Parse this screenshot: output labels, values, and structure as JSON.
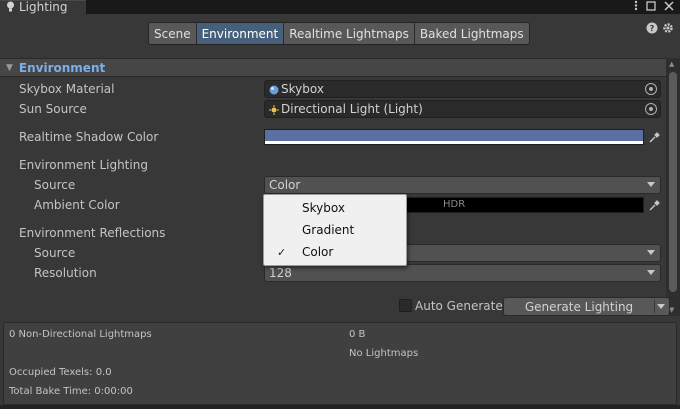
{
  "window": {
    "tab_title": "Lighting",
    "menu_icon": "kebab-icon",
    "maximize_icon": "maximize-icon",
    "close_icon": "close-icon"
  },
  "toolbar": {
    "help_icon": "help-icon",
    "settings_icon": "gear-icon",
    "tabs": [
      {
        "label": "Scene",
        "active": false
      },
      {
        "label": "Environment",
        "active": true
      },
      {
        "label": "Realtime Lightmaps",
        "active": false
      },
      {
        "label": "Baked Lightmaps",
        "active": false
      }
    ]
  },
  "section": {
    "title": "Environment"
  },
  "fields": {
    "skybox_material_label": "Skybox Material",
    "skybox_material_value": "Skybox",
    "sun_source_label": "Sun Source",
    "sun_source_value": "Directional Light (Light)",
    "realtime_shadow_color_label": "Realtime Shadow Color",
    "realtime_shadow_color": "#5c6fa3",
    "environment_lighting_label": "Environment Lighting",
    "source_label": "Source",
    "source_value": "Color",
    "ambient_color_label": "Ambient Color",
    "ambient_color": "#000000",
    "ambient_hdr_label": "HDR",
    "environment_reflections_label": "Environment Reflections",
    "reflections_source_label": "Source",
    "resolution_label": "Resolution",
    "resolution_value": "128"
  },
  "source_popup": {
    "options": [
      {
        "label": "Skybox",
        "checked": false
      },
      {
        "label": "Gradient",
        "checked": false
      },
      {
        "label": "Color",
        "checked": true
      }
    ],
    "check_glyph": "✓"
  },
  "bake": {
    "auto_generate_label": "Auto Generate",
    "auto_generate_checked": false,
    "generate_button_label": "Generate Lighting"
  },
  "stats": {
    "lightmaps": "0 Non-Directional Lightmaps",
    "size": "0 B",
    "no_lightmaps": "No Lightmaps",
    "occupied_texels": "Occupied Texels: 0.0",
    "total_bake_time": "Total Bake Time: 0:00:00"
  },
  "colors": {
    "accent": "#46607c",
    "section_title": "#7ab0ea",
    "shadow_color": "#5c6fa3"
  }
}
